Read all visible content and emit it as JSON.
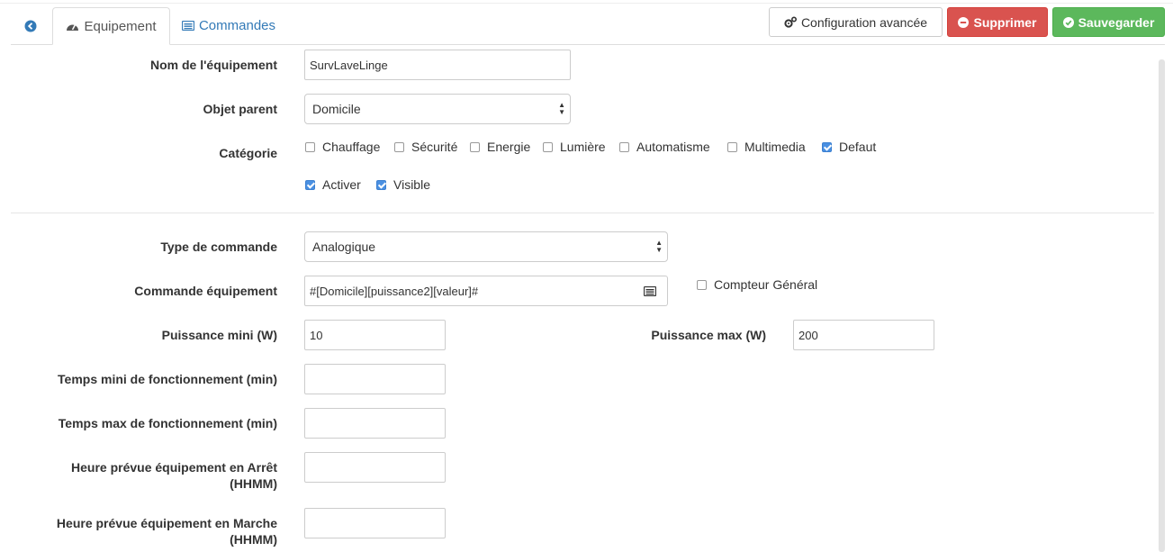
{
  "tabs": {
    "back_icon": "circle-arrow-left-icon",
    "equipement": "Equipement",
    "commandes": "Commandes"
  },
  "buttons": {
    "config": "Configuration avancée",
    "delete": "Supprimer",
    "save": "Sauvegarder"
  },
  "form": {
    "name_label": "Nom de l'équipement",
    "name_value": "SurvLaveLinge",
    "parent_label": "Objet parent",
    "parent_value": "Domicile",
    "category_label": "Catégorie",
    "categories": [
      {
        "label": "Chauffage",
        "checked": false
      },
      {
        "label": "Sécurité",
        "checked": false
      },
      {
        "label": "Energie",
        "checked": false
      },
      {
        "label": "Lumière",
        "checked": false
      },
      {
        "label": "Automatisme",
        "checked": false
      },
      {
        "label": "Multimedia",
        "checked": false
      },
      {
        "label": "Defaut",
        "checked": true
      }
    ],
    "activer": "Activer",
    "visible": "Visible",
    "type_label": "Type de commande",
    "type_value": "Analogique",
    "cmd_label": "Commande équipement",
    "cmd_value": "#[Domicile][puissance2][valeur]#",
    "compteur": "Compteur Général",
    "pmin_label": "Puissance mini (W)",
    "pmin_value": "10",
    "pmax_label": "Puissance max (W)",
    "pmax_value": "200",
    "tmin_label": "Temps mini de fonctionnement (min)",
    "tmax_label": "Temps max de fonctionnement (min)",
    "arret_label_1": "Heure prévue équipement en Arrêt",
    "arret_label_2": "(HHMM)",
    "marche_label_1": "Heure prévue équipement en Marche",
    "marche_label_2": "(HHMM)"
  },
  "colors": {
    "link": "#337ab7",
    "danger": "#d9534f",
    "success": "#5cb85c",
    "checkbox": "#4a90e2"
  }
}
